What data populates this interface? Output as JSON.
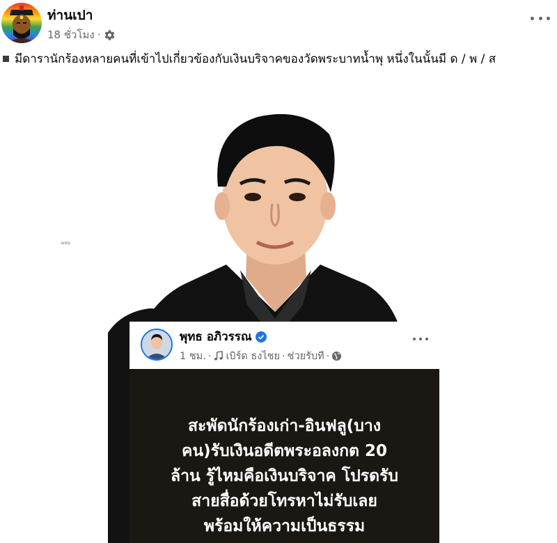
{
  "post": {
    "author": "ท่านเปา",
    "time": "18 ชั่วโมง",
    "separator": "·",
    "privacy_icon": "gear-icon",
    "text": "มีดารานักร้องหลายคนที่เข้าไปเกี่ยวข้องกับเงินบริจาคของวัดพระบาทน้ำพุ หนึ่งในนั้นมี ด / พ / ส"
  },
  "media": {
    "photo_mark": "ผลม",
    "embedded_post": {
      "author": "พุทธ อภิวรรณ",
      "verified_icon": "verified-badge-icon",
      "time": "1 ชม.",
      "separator": "·",
      "music_icon": "music-note-icon",
      "song": "เบิร์ด ธงไชย",
      "song_title": "ช่วยรับที",
      "audience_icon": "globe-icon",
      "quote_lines": [
        "สะพัดนักร้องเก่า-อินฟลู(บาง",
        "คน)รับเงินอดีตพระอลงกต 20",
        "ล้าน รู้ไหมคือเงินบริจาค โปรดรับ",
        "สายสื่อด้วยโทรหาไม่รับเลย",
        "พร้อมให้ความเป็นธรรม"
      ]
    }
  },
  "colors": {
    "meta_text": "#65676b",
    "quote_bg": "#1b1814",
    "quote_text": "#ffffff",
    "verified": "#1b74e4"
  }
}
